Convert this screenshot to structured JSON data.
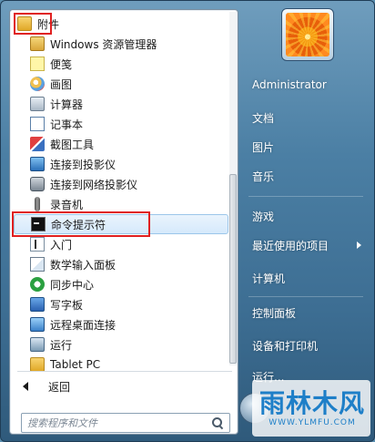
{
  "programs": {
    "folder_label": "附件",
    "items": [
      {
        "label": "Windows 资源管理器",
        "icon": "explorer-icon"
      },
      {
        "label": "便笺",
        "icon": "sticky-notes-icon"
      },
      {
        "label": "画图",
        "icon": "paint-icon"
      },
      {
        "label": "计算器",
        "icon": "calculator-icon"
      },
      {
        "label": "记事本",
        "icon": "notepad-icon"
      },
      {
        "label": "截图工具",
        "icon": "snipping-tool-icon"
      },
      {
        "label": "连接到投影仪",
        "icon": "projector-icon"
      },
      {
        "label": "连接到网络投影仪",
        "icon": "network-projector-icon"
      },
      {
        "label": "录音机",
        "icon": "microphone-icon"
      },
      {
        "label": "命令提示符",
        "icon": "command-prompt-icon"
      },
      {
        "label": "入门",
        "icon": "getting-started-icon"
      },
      {
        "label": "数学输入面板",
        "icon": "math-input-icon"
      },
      {
        "label": "同步中心",
        "icon": "sync-center-icon"
      },
      {
        "label": "写字板",
        "icon": "wordpad-icon"
      },
      {
        "label": "远程桌面连接",
        "icon": "remote-desktop-icon"
      },
      {
        "label": "运行",
        "icon": "run-icon"
      },
      {
        "label": "Tablet PC",
        "icon": "folder-icon"
      }
    ],
    "back_label": "返回"
  },
  "search": {
    "placeholder": "搜索程序和文件"
  },
  "right_menu": {
    "user_name": "Administrator",
    "items": [
      "文档",
      "图片",
      "音乐",
      "游戏",
      "最近使用的项目",
      "计算机",
      "控制面板",
      "设备和打印机",
      "运行..."
    ]
  },
  "watermark": {
    "main": "雨林木风",
    "sub": "WWW.YLMFU.COM"
  },
  "colors": {
    "highlight_border": "#e02020",
    "selection_fill": "#d5e9fb",
    "frame_blue": "#4b7fa4",
    "watermark_blue": "#1e7fc8"
  }
}
